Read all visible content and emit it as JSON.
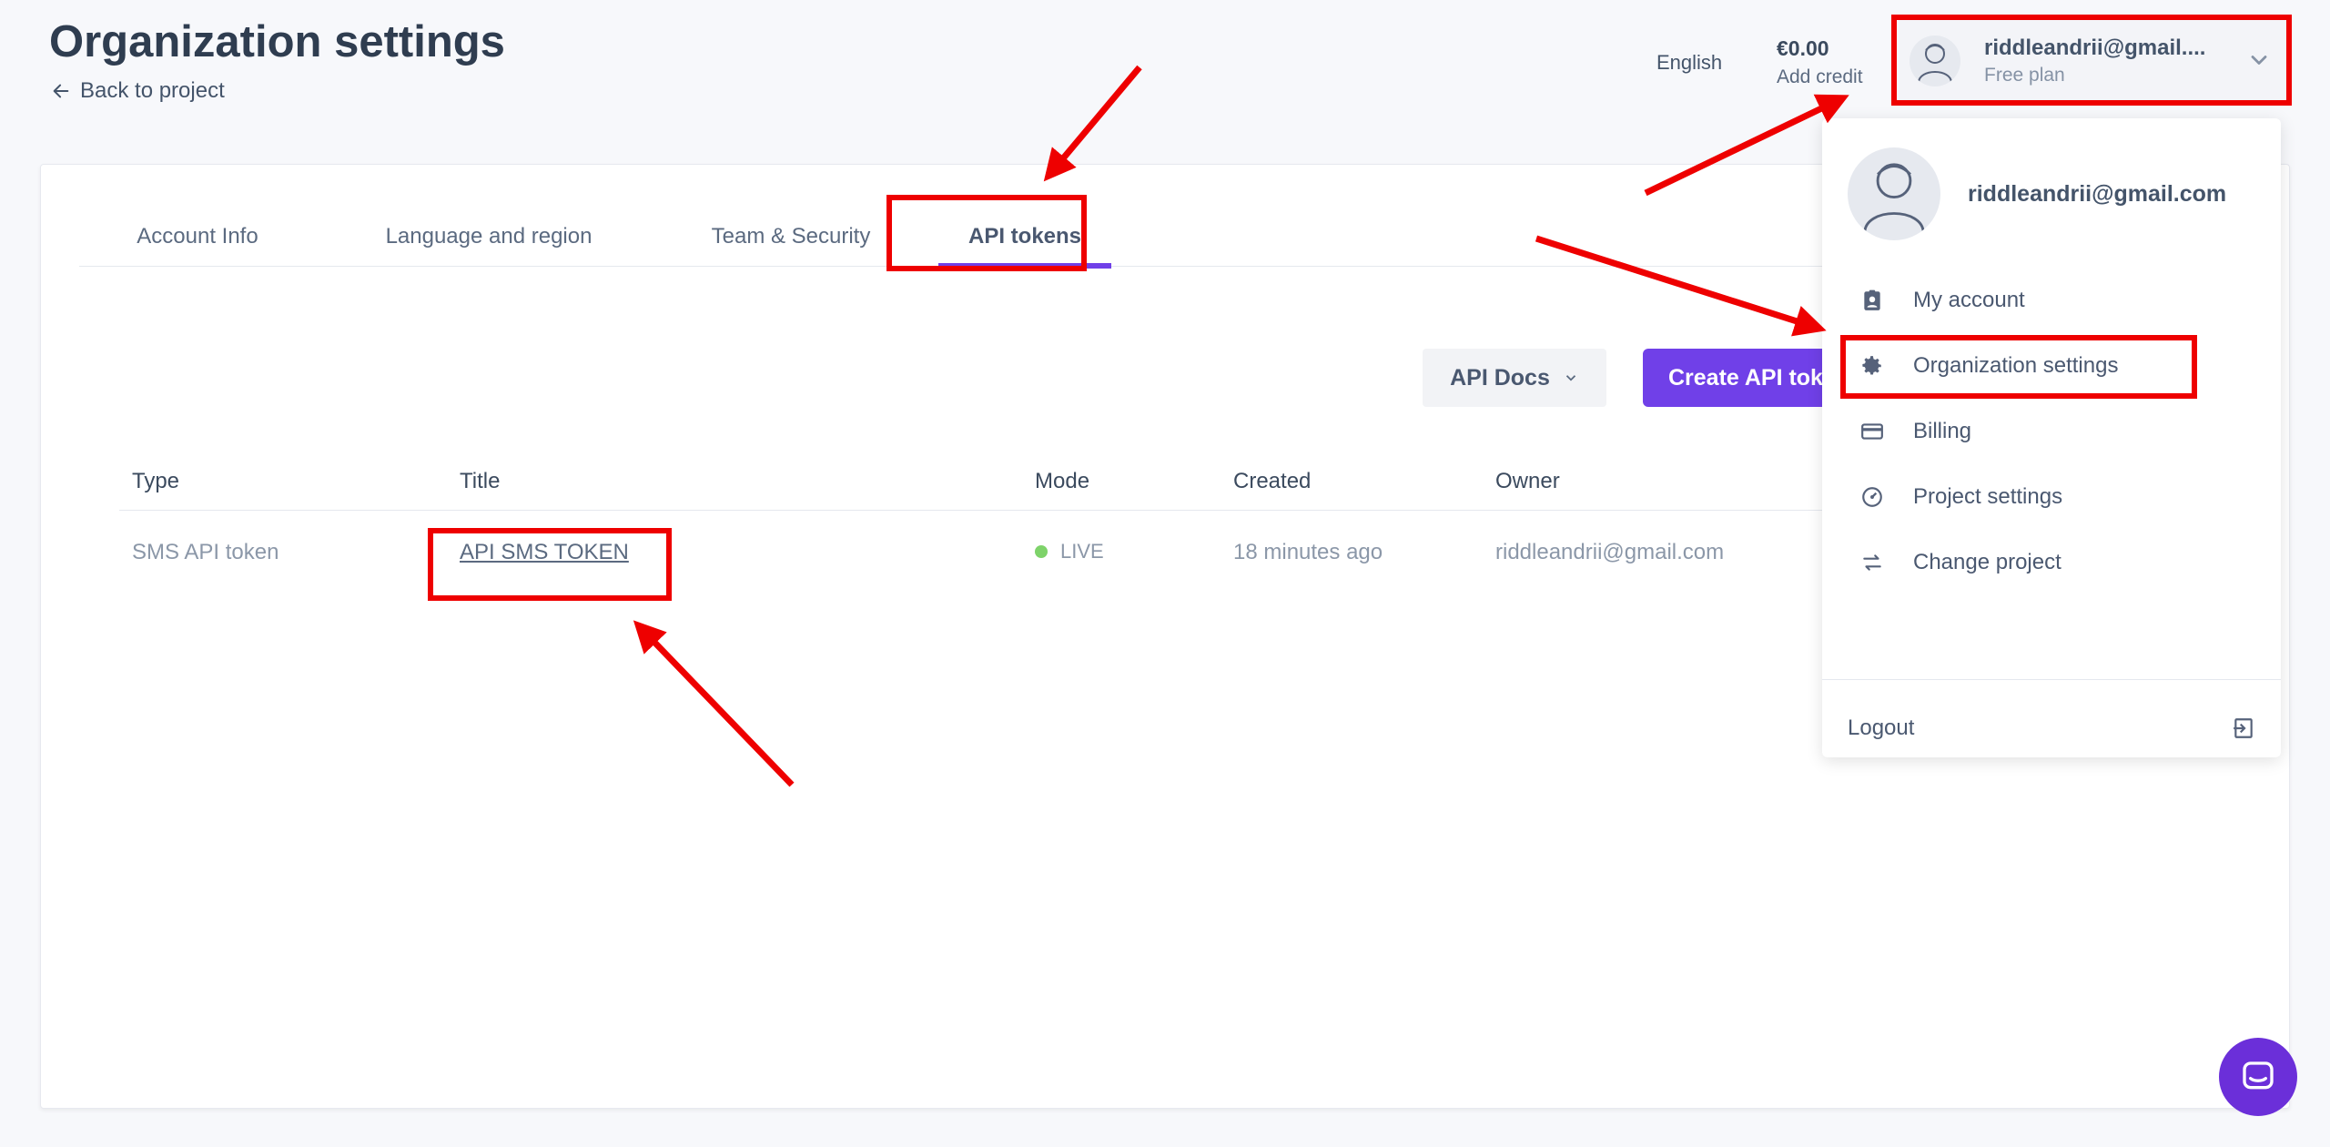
{
  "header": {
    "title": "Organization settings",
    "back_label": "Back to project",
    "language": "English",
    "credit_amount": "€0.00",
    "add_credit": "Add credit"
  },
  "user": {
    "email_short": "riddleandrii@gmail....",
    "plan": "Free plan",
    "email_full": "riddleandrii@gmail.com"
  },
  "tabs": [
    {
      "label": "Account Info"
    },
    {
      "label": "Language and region"
    },
    {
      "label": "Team & Security"
    },
    {
      "label": "API tokens",
      "active": true
    }
  ],
  "toolbar": {
    "api_docs": "API Docs",
    "create_token": "Create API tok"
  },
  "table": {
    "columns": [
      "Type",
      "Title",
      "Mode",
      "Created",
      "Owner"
    ],
    "rows": [
      {
        "type": "SMS API token",
        "title": "API SMS TOKEN",
        "mode": "LIVE",
        "created": "18 minutes ago",
        "owner": "riddleandrii@gmail.com"
      }
    ]
  },
  "menu": {
    "items": [
      {
        "label": "My account",
        "icon": "account-badge-icon"
      },
      {
        "label": "Organization settings",
        "icon": "gear-icon"
      },
      {
        "label": "Billing",
        "icon": "credit-card-icon"
      },
      {
        "label": "Project settings",
        "icon": "gauge-icon"
      },
      {
        "label": "Change project",
        "icon": "swap-arrows-icon"
      }
    ],
    "logout": "Logout"
  },
  "colors": {
    "accent": "#7040e8",
    "annotation": "#ee0000",
    "live": "#7ed36a"
  }
}
